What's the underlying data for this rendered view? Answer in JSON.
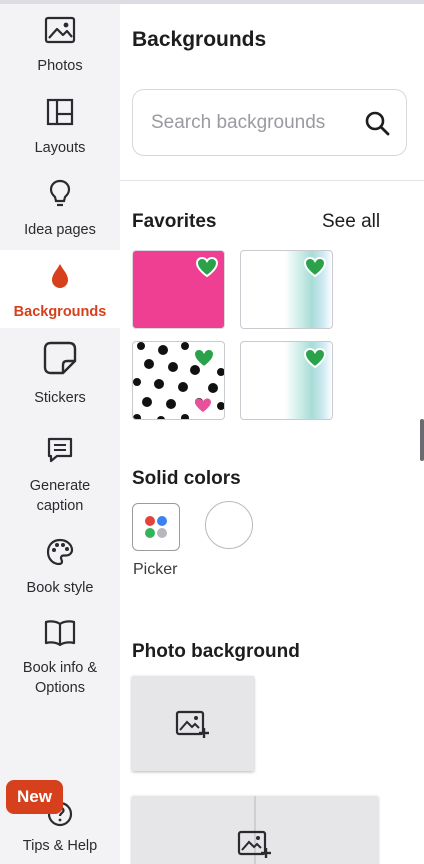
{
  "sidebar": {
    "items": [
      {
        "label": "Photos",
        "icon": "image-icon"
      },
      {
        "label": "Layouts",
        "icon": "layout-icon"
      },
      {
        "label": "Idea pages",
        "icon": "lightbulb-icon"
      },
      {
        "label": "Backgrounds",
        "icon": "drop-icon",
        "active": true
      },
      {
        "label": "Stickers",
        "icon": "sticker-icon"
      },
      {
        "label": "Generate caption",
        "line1": "Generate",
        "line2": "caption",
        "icon": "caption-icon"
      },
      {
        "label": "Book style",
        "icon": "palette-icon"
      },
      {
        "label": "Book info & Options",
        "line1": "Book info &",
        "line2": "Options",
        "icon": "book-icon"
      },
      {
        "label": "Tips & Help",
        "icon": "help-icon",
        "badge": "New"
      }
    ]
  },
  "panel": {
    "title": "Backgrounds",
    "search_placeholder": "Search backgrounds",
    "favorites_title": "Favorites",
    "see_all": "See all",
    "favorites": [
      {
        "name": "pink-solid",
        "favorited": true
      },
      {
        "name": "teal-watercolor",
        "favorited": true
      },
      {
        "name": "polka-dots",
        "favorited": true
      },
      {
        "name": "teal-watercolor-2",
        "favorited": true
      }
    ],
    "solid_colors_title": "Solid colors",
    "picker_label": "Picker",
    "photo_background_title": "Photo background"
  },
  "colors": {
    "accent": "#d6401d",
    "heart": "#2aa24a",
    "pink_tile": "#ee3f93",
    "sidebar_bg": "#f3f3f6"
  }
}
